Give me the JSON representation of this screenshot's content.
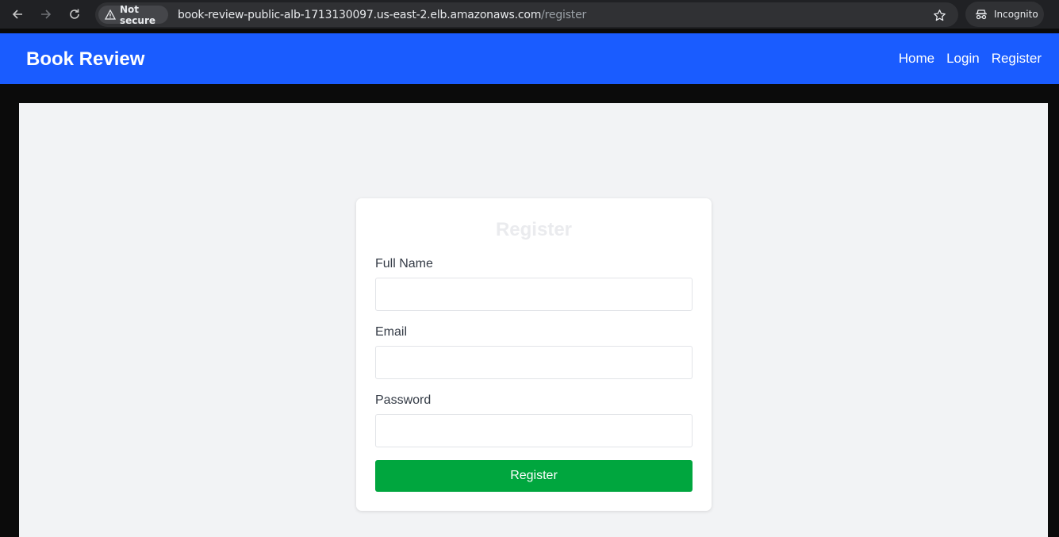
{
  "browser": {
    "security_label": "Not secure",
    "url_host": "book-review-public-alb-1713130097.us-east-2.elb.amazonaws.com",
    "url_path": "/register",
    "profile_label": "Incognito"
  },
  "header": {
    "brand": "Book Review",
    "nav": [
      "Home",
      "Login",
      "Register"
    ],
    "color": "#1a5cff"
  },
  "form": {
    "title": "Register",
    "fields": [
      {
        "label": "Full Name",
        "value": "",
        "placeholder": ""
      },
      {
        "label": "Email",
        "value": "",
        "placeholder": ""
      },
      {
        "label": "Password",
        "value": "",
        "placeholder": ""
      }
    ],
    "submit_label": "Register",
    "submit_color": "#00a63e"
  }
}
